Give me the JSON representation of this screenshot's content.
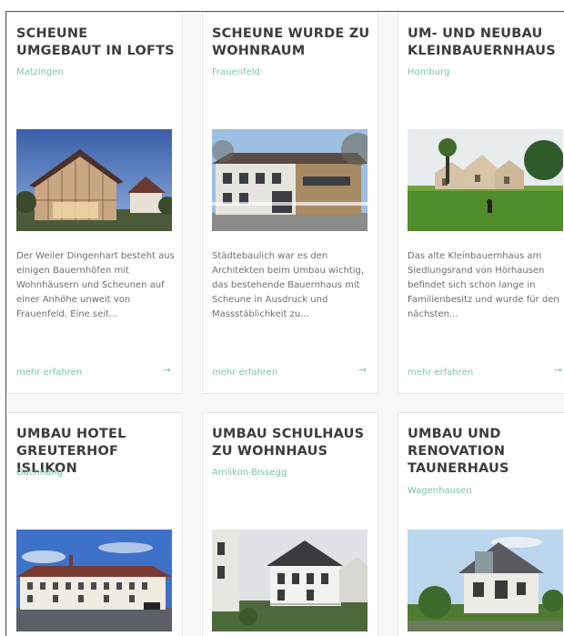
{
  "cards": [
    {
      "title": "SCHEUNE UMGEBAUT IN LOFTS",
      "location": "Matzingen",
      "description": "Der Weiler Dingenhart besteht aus einigen Bauernhöfen mit Wohnhäusern und Scheunen auf einer Anhöhe unweit von Frauenfeld. Eine seit...",
      "link_label": "mehr erfahren",
      "arrow_icon": "arrow-right-icon"
    },
    {
      "title": "SCHEUNE WURDE ZU WOHNRAUM",
      "location": "Frauenfeld",
      "description": "Städtebaulich war es den Architekten beim Umbau wichtig, das bestehende Bauernhaus mit Scheune in Ausdruck und Massstäblichkeit zu...",
      "link_label": "mehr erfahren",
      "arrow_icon": "arrow-right-icon"
    },
    {
      "title": "UM- UND NEUBAU KLEINBAUERNHAUS",
      "location": "Homburg",
      "description": "Das alte Kleinbauernhaus am Siedlungsrand von Hörhausen befindet sich schon lange in Familienbesitz und wurde für den nächsten...",
      "link_label": "mehr erfahren",
      "arrow_icon": "arrow-right-icon"
    },
    {
      "title": "UMBAU HOTEL GREUTERHOF ISLIKON",
      "location": "Gachnang"
    },
    {
      "title": "UMBAU SCHULHAUS ZU WOHNHAUS",
      "location": "Amlikon-Bissegg"
    },
    {
      "title": "UMBAU UND RENOVATION TAUNERHAUS",
      "location": "Wagenhausen"
    }
  ],
  "colors": {
    "accent": "#7cc3a8",
    "title": "#3a3d40",
    "text": "#6b6e70",
    "background": "#f7f8f7"
  }
}
